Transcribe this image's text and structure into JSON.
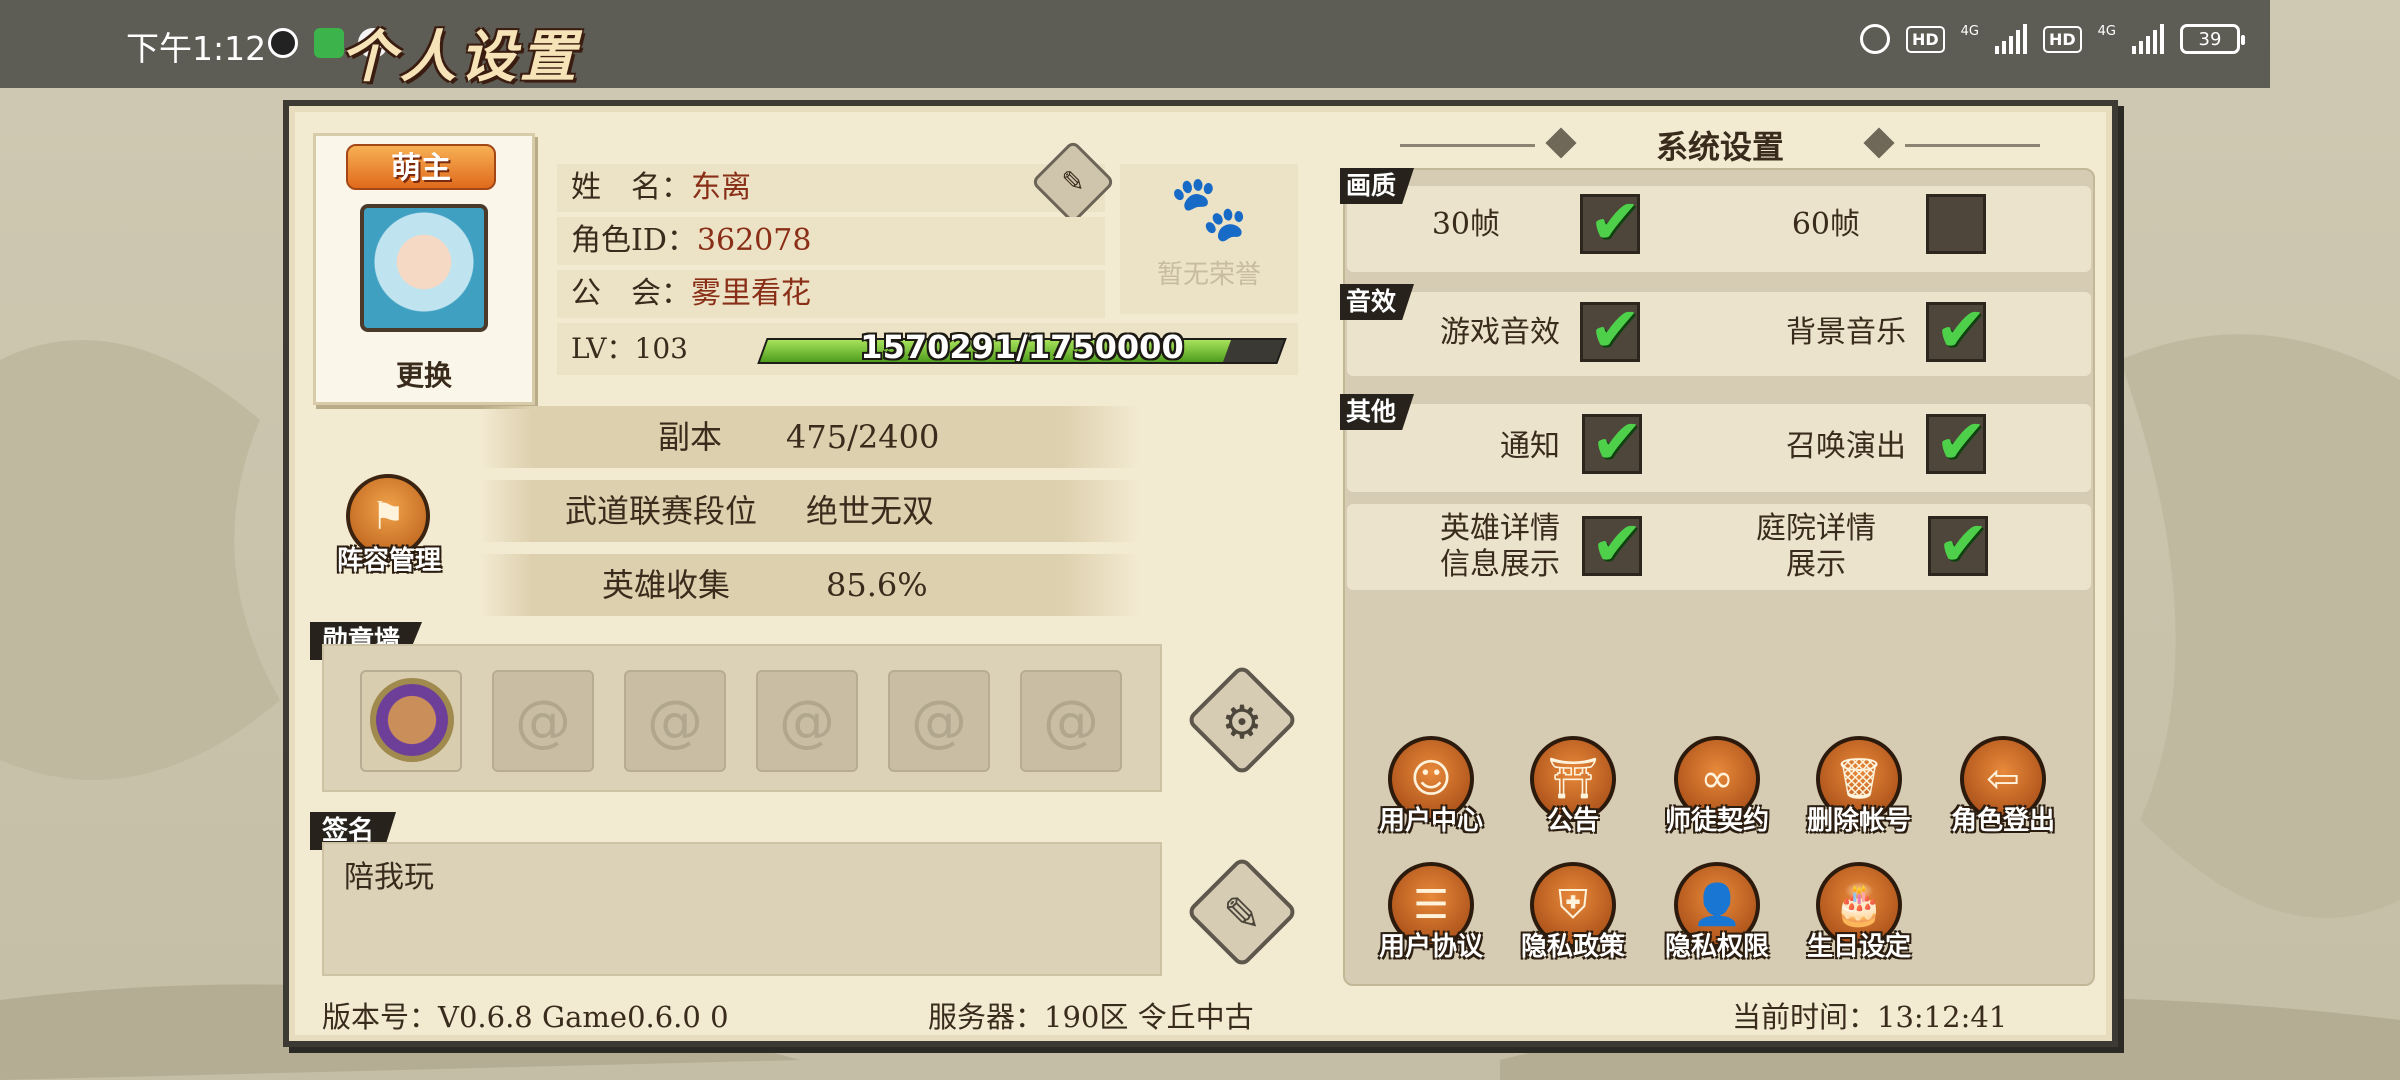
{
  "statusbar": {
    "time": "下午1:12",
    "network_left": "HD",
    "network_right": "HD",
    "lte1": "4G",
    "lte2": "4G",
    "battery": "39"
  },
  "page": {
    "title": "个人设置"
  },
  "profile": {
    "role_badge": "萌主",
    "change_label": "更换",
    "name_label": "姓　名：",
    "name_value": "东离",
    "id_label": "角色ID：",
    "id_value": "362078",
    "guild_label": "公　会：",
    "guild_value": "雾里看花",
    "honor_text": "暂无荣誉",
    "level_label": "LV：",
    "level_value": "103",
    "xp_text": "1570291/1750000",
    "xp_fraction": 0.8973
  },
  "stats": {
    "dungeon_label": "副本",
    "dungeon_value": "475/2400",
    "rank_label": "武道联赛段位",
    "rank_value": "绝世无双",
    "collect_label": "英雄收集",
    "collect_value": "85.6%",
    "lineup_label": "阵容管理"
  },
  "medal_wall": {
    "title": "勋章墙"
  },
  "signature": {
    "title": "签名",
    "text": "陪我玩"
  },
  "footer": {
    "version": "版本号：V0.6.8 Game0.6.0 0",
    "server": "服务器：190区 令丘中古",
    "current_time": "当前时间：13:12:41"
  },
  "system": {
    "title": "系统设置",
    "quality_tag": "画质",
    "fps30": "30帧",
    "fps60": "60帧",
    "sound_tag": "音效",
    "game_sound": "游戏音效",
    "bg_music": "背景音乐",
    "other_tag": "其他",
    "notify": "通知",
    "summon_show": "召唤演出",
    "hero_detail_1": "英雄详情",
    "hero_detail_2": "信息展示",
    "yard_detail_1": "庭院详情",
    "yard_detail_2": "展示",
    "checks": {
      "fps30": true,
      "fps60": false,
      "game_sound": true,
      "bg_music": true,
      "notify": true,
      "summon_show": true,
      "hero_detail": true,
      "yard_detail": true
    }
  },
  "account": {
    "user_center": "用户中心",
    "notice": "公告",
    "mentor": "师徒契约",
    "delete": "删除帐号",
    "logout": "角色登出",
    "agreement": "用户协议",
    "privacy": "隐私政策",
    "permissions": "隐私权限",
    "birthday": "生日设定"
  },
  "colors": {
    "panel_bg": "#f3ead2",
    "accent_orange": "#e06a1d",
    "check_green": "#4ed04b",
    "value_red": "#8a2f17"
  }
}
